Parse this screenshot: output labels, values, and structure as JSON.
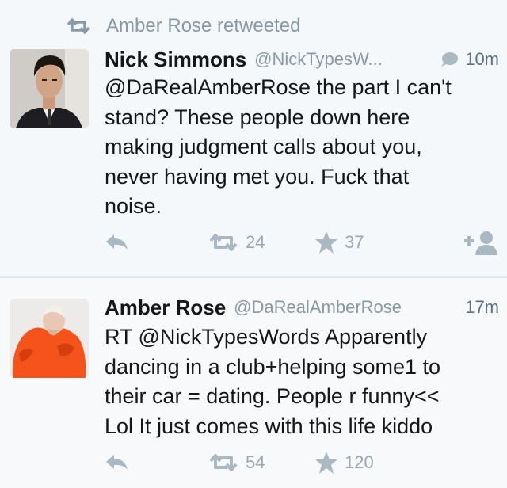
{
  "retweet_context": {
    "text": "Amber Rose retweeted"
  },
  "tweets": [
    {
      "name": "Nick Simmons",
      "handle": "@NickTypesW...",
      "time": "10m",
      "text": "@DaRealAmberRose the part I can't\nstand? These people down here\nmaking judgment calls about you,\nnever having met you. Fuck that\nnoise.",
      "retweets": "24",
      "favorites": "37"
    },
    {
      "name": "Amber Rose",
      "handle": "@DaRealAmberRose",
      "time": "17m",
      "text": "RT @NickTypesWords Apparently\ndancing in a club+helping some1 to\ntheir car = dating. People r funny<<\nLol It just comes with this life kiddo",
      "retweets": "54",
      "favorites": "120"
    }
  ],
  "colors": {
    "accent_gray": "#8899a6",
    "icon_gray": "#aab8c2",
    "text": "#14171a"
  }
}
